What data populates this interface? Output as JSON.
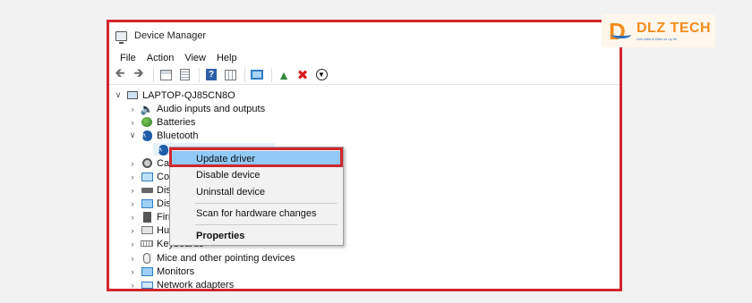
{
  "window": {
    "title": "Device Manager",
    "app_icon": "device-manager-icon"
  },
  "menubar": [
    "File",
    "Action",
    "View",
    "Help"
  ],
  "toolbar": {
    "buttons": [
      "back-arrow-icon",
      "forward-arrow-icon",
      "properties-icon",
      "details-icon",
      "help-icon",
      "grid-view-icon",
      "scan-monitor-icon",
      "add-hardware-icon",
      "uninstall-x-icon",
      "update-down-arrow-icon"
    ]
  },
  "tree": {
    "root": "LAPTOP-QJ85CN8O",
    "items": [
      {
        "label": "Audio inputs and outputs",
        "expanded": false
      },
      {
        "label": "Batteries",
        "expanded": false
      },
      {
        "label": "Bluetooth",
        "expanded": true
      },
      {
        "label": "Cam",
        "expanded": false
      },
      {
        "label": "Com",
        "expanded": false
      },
      {
        "label": "Disk",
        "expanded": false
      },
      {
        "label": "Disp",
        "expanded": false
      },
      {
        "label": "Firm",
        "expanded": false
      },
      {
        "label": "Hum",
        "expanded": false
      },
      {
        "label": "Keyboards",
        "expanded": false
      },
      {
        "label": "Mice and other pointing devices",
        "expanded": false
      },
      {
        "label": "Monitors",
        "expanded": false
      },
      {
        "label": "Network adapters",
        "expanded": false
      }
    ]
  },
  "context_menu": {
    "items": [
      "Update driver",
      "Disable device",
      "Uninstall device",
      "Scan for hardware changes",
      "Properties"
    ],
    "highlighted": "Update driver"
  },
  "logo": {
    "name": "DLZ TECH",
    "tagline": "Linh kiện & Dịch vụ uy tín"
  },
  "colors": {
    "annotation_red": "#d22630",
    "highlight_blue": "#91c9f7",
    "logo_orange": "#f28c1e",
    "logo_blue": "#2f6dbc"
  }
}
